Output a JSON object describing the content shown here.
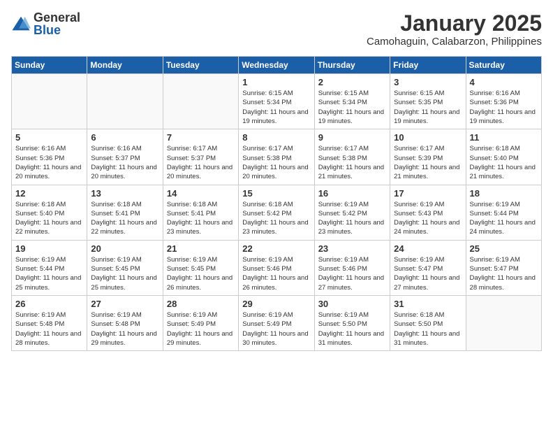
{
  "logo": {
    "general": "General",
    "blue": "Blue"
  },
  "title": "January 2025",
  "location": "Camohaguin, Calabarzon, Philippines",
  "headers": [
    "Sunday",
    "Monday",
    "Tuesday",
    "Wednesday",
    "Thursday",
    "Friday",
    "Saturday"
  ],
  "weeks": [
    [
      {
        "day": "",
        "info": ""
      },
      {
        "day": "",
        "info": ""
      },
      {
        "day": "",
        "info": ""
      },
      {
        "day": "1",
        "info": "Sunrise: 6:15 AM\nSunset: 5:34 PM\nDaylight: 11 hours and 19 minutes."
      },
      {
        "day": "2",
        "info": "Sunrise: 6:15 AM\nSunset: 5:34 PM\nDaylight: 11 hours and 19 minutes."
      },
      {
        "day": "3",
        "info": "Sunrise: 6:15 AM\nSunset: 5:35 PM\nDaylight: 11 hours and 19 minutes."
      },
      {
        "day": "4",
        "info": "Sunrise: 6:16 AM\nSunset: 5:36 PM\nDaylight: 11 hours and 19 minutes."
      }
    ],
    [
      {
        "day": "5",
        "info": "Sunrise: 6:16 AM\nSunset: 5:36 PM\nDaylight: 11 hours and 20 minutes."
      },
      {
        "day": "6",
        "info": "Sunrise: 6:16 AM\nSunset: 5:37 PM\nDaylight: 11 hours and 20 minutes."
      },
      {
        "day": "7",
        "info": "Sunrise: 6:17 AM\nSunset: 5:37 PM\nDaylight: 11 hours and 20 minutes."
      },
      {
        "day": "8",
        "info": "Sunrise: 6:17 AM\nSunset: 5:38 PM\nDaylight: 11 hours and 20 minutes."
      },
      {
        "day": "9",
        "info": "Sunrise: 6:17 AM\nSunset: 5:38 PM\nDaylight: 11 hours and 21 minutes."
      },
      {
        "day": "10",
        "info": "Sunrise: 6:17 AM\nSunset: 5:39 PM\nDaylight: 11 hours and 21 minutes."
      },
      {
        "day": "11",
        "info": "Sunrise: 6:18 AM\nSunset: 5:40 PM\nDaylight: 11 hours and 21 minutes."
      }
    ],
    [
      {
        "day": "12",
        "info": "Sunrise: 6:18 AM\nSunset: 5:40 PM\nDaylight: 11 hours and 22 minutes."
      },
      {
        "day": "13",
        "info": "Sunrise: 6:18 AM\nSunset: 5:41 PM\nDaylight: 11 hours and 22 minutes."
      },
      {
        "day": "14",
        "info": "Sunrise: 6:18 AM\nSunset: 5:41 PM\nDaylight: 11 hours and 23 minutes."
      },
      {
        "day": "15",
        "info": "Sunrise: 6:18 AM\nSunset: 5:42 PM\nDaylight: 11 hours and 23 minutes."
      },
      {
        "day": "16",
        "info": "Sunrise: 6:19 AM\nSunset: 5:42 PM\nDaylight: 11 hours and 23 minutes."
      },
      {
        "day": "17",
        "info": "Sunrise: 6:19 AM\nSunset: 5:43 PM\nDaylight: 11 hours and 24 minutes."
      },
      {
        "day": "18",
        "info": "Sunrise: 6:19 AM\nSunset: 5:44 PM\nDaylight: 11 hours and 24 minutes."
      }
    ],
    [
      {
        "day": "19",
        "info": "Sunrise: 6:19 AM\nSunset: 5:44 PM\nDaylight: 11 hours and 25 minutes."
      },
      {
        "day": "20",
        "info": "Sunrise: 6:19 AM\nSunset: 5:45 PM\nDaylight: 11 hours and 25 minutes."
      },
      {
        "day": "21",
        "info": "Sunrise: 6:19 AM\nSunset: 5:45 PM\nDaylight: 11 hours and 26 minutes."
      },
      {
        "day": "22",
        "info": "Sunrise: 6:19 AM\nSunset: 5:46 PM\nDaylight: 11 hours and 26 minutes."
      },
      {
        "day": "23",
        "info": "Sunrise: 6:19 AM\nSunset: 5:46 PM\nDaylight: 11 hours and 27 minutes."
      },
      {
        "day": "24",
        "info": "Sunrise: 6:19 AM\nSunset: 5:47 PM\nDaylight: 11 hours and 27 minutes."
      },
      {
        "day": "25",
        "info": "Sunrise: 6:19 AM\nSunset: 5:47 PM\nDaylight: 11 hours and 28 minutes."
      }
    ],
    [
      {
        "day": "26",
        "info": "Sunrise: 6:19 AM\nSunset: 5:48 PM\nDaylight: 11 hours and 28 minutes."
      },
      {
        "day": "27",
        "info": "Sunrise: 6:19 AM\nSunset: 5:48 PM\nDaylight: 11 hours and 29 minutes."
      },
      {
        "day": "28",
        "info": "Sunrise: 6:19 AM\nSunset: 5:49 PM\nDaylight: 11 hours and 29 minutes."
      },
      {
        "day": "29",
        "info": "Sunrise: 6:19 AM\nSunset: 5:49 PM\nDaylight: 11 hours and 30 minutes."
      },
      {
        "day": "30",
        "info": "Sunrise: 6:19 AM\nSunset: 5:50 PM\nDaylight: 11 hours and 31 minutes."
      },
      {
        "day": "31",
        "info": "Sunrise: 6:18 AM\nSunset: 5:50 PM\nDaylight: 11 hours and 31 minutes."
      },
      {
        "day": "",
        "info": ""
      }
    ]
  ]
}
